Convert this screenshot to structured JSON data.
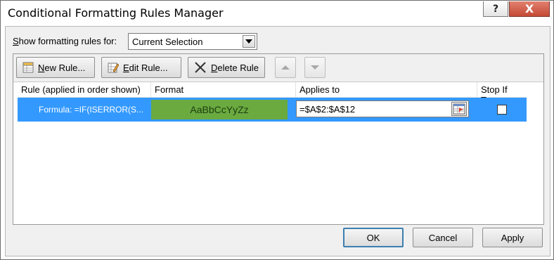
{
  "window": {
    "title": "Conditional Formatting Rules Manager",
    "help_label": "?",
    "close_label": "X"
  },
  "show_rules": {
    "label_prefix": "",
    "label_hotkey": "S",
    "label_rest": "how formatting rules for:",
    "selected": "Current Selection"
  },
  "toolbar": {
    "new_hotkey": "N",
    "new_rest": "ew Rule...",
    "edit_hotkey": "E",
    "edit_rest": "dit Rule...",
    "delete_hotkey": "D",
    "delete_rest": "elete Rule"
  },
  "grid": {
    "columns": [
      "Rule (applied in order shown)",
      "Format",
      "Applies to",
      "Stop If True"
    ],
    "rows": [
      {
        "rule": "Formula: =IF(ISERROR(S...",
        "format_preview": "AaBbCcYyZz",
        "applies_to": "=$A$2:$A$12",
        "stop_if_true": false
      }
    ]
  },
  "buttons": {
    "ok": "OK",
    "cancel": "Cancel",
    "apply": "Apply"
  },
  "colors": {
    "selection": "#3399ff",
    "format_fill": "#6aaa3f",
    "close_button": "#c44a35"
  }
}
